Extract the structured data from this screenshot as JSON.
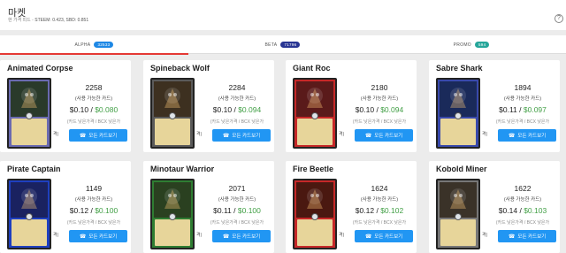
{
  "header": {
    "title": "마켓",
    "subtitle_prefix": "현 가격 피드 -",
    "steem_label": "STEEM: 0.423,",
    "sbd_label": "SBD: 0.851",
    "help_icon": "?"
  },
  "tabs": [
    {
      "label": "ALPHA",
      "count": "32533",
      "color": "#1e88e5"
    },
    {
      "label": "BETA",
      "count": "71796",
      "color": "#283593"
    },
    {
      "label": "PROMO",
      "count": "594",
      "color": "#26a69a"
    }
  ],
  "cards": [
    {
      "name": "Animated Corpse",
      "count": "2258",
      "avail": "(사용 가능한 카드)",
      "price_low": "$0.10",
      "price_bcx": "$0.080",
      "price_label": "(카드 낮은가격 / BCX 낮은가",
      "cut": "격)",
      "button": "모든 카드보기",
      "frame_color": "#6a6ab0",
      "art_color": "#2a3a2a"
    },
    {
      "name": "Spineback Wolf",
      "count": "2284",
      "avail": "(사용 가능한 카드)",
      "price_low": "$0.10",
      "price_bcx": "$0.094",
      "price_label": "(카드 낮은가격 / BCX 낮은가",
      "cut": "격)",
      "button": "모든 카드보기",
      "frame_color": "#5a5a5a",
      "art_color": "#3d3020"
    },
    {
      "name": "Giant Roc",
      "count": "2180",
      "avail": "(사용 가능한 카드)",
      "price_low": "$0.10",
      "price_bcx": "$0.094",
      "price_label": "(카드 낮은가격 / BCX 낮은가",
      "cut": "격)",
      "button": "모든 카드보기",
      "frame_color": "#c62828",
      "art_color": "#5a1a1a"
    },
    {
      "name": "Sabre Shark",
      "count": "1894",
      "avail": "(사용 가능한 카드)",
      "price_low": "$0.11",
      "price_bcx": "$0.097",
      "price_label": "(카드 낮은가격 / BCX 낮은가",
      "cut": "격)",
      "button": "모든 카드보기",
      "frame_color": "#3949ab",
      "art_color": "#1a2a5a"
    },
    {
      "name": "Pirate Captain",
      "count": "1149",
      "avail": "(사용 가능한 카드)",
      "price_low": "$0.12",
      "price_bcx": "$0.100",
      "price_label": "(카드 낮은가격 / BCX 낮은가",
      "cut": "격)",
      "button": "모든 카드보기",
      "frame_color": "#1e3fbf",
      "art_color": "#1a2260"
    },
    {
      "name": "Minotaur Warrior",
      "count": "2071",
      "avail": "(사용 가능한 카드)",
      "price_low": "$0.11",
      "price_bcx": "$0.100",
      "price_label": "(카드 낮은가격 / BCX 낮은가",
      "cut": "격)",
      "button": "모든 카드보기",
      "frame_color": "#2e7d32",
      "art_color": "#2a4020"
    },
    {
      "name": "Fire Beetle",
      "count": "1624",
      "avail": "(사용 가능한 카드)",
      "price_low": "$0.12",
      "price_bcx": "$0.102",
      "price_label": "(카드 낮은가격 / BCX 낮은가",
      "cut": "격)",
      "button": "모든 카드보기",
      "frame_color": "#c62828",
      "art_color": "#4a1810"
    },
    {
      "name": "Kobold Miner",
      "count": "1622",
      "avail": "(사용 가능한 카드)",
      "price_low": "$0.14",
      "price_bcx": "$0.103",
      "price_label": "(카드 낮은가격 / BCX 낮은가",
      "cut": "격)",
      "button": "모든 카드보기",
      "frame_color": "#777777",
      "art_color": "#3a3228"
    }
  ]
}
